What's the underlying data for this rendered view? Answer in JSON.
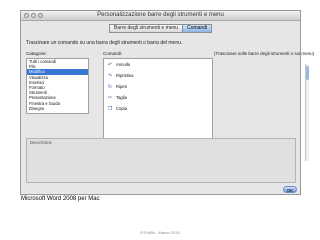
{
  "window": {
    "title": "Personalizzazione barre degli strumenti e menu",
    "tabs": [
      {
        "label": "Barre degli strumenti e menu"
      },
      {
        "label": "Comandi"
      }
    ]
  },
  "instruction": "Trascinare un comando su una barra degli strumenti o barra del menu.",
  "categories": {
    "label": "Categorie:",
    "items": [
      "Tutti i comandi",
      "File",
      "Modifica",
      "Visualizza",
      "Inserisci",
      "Formato",
      "Strumenti",
      "Presentazione",
      "Finestra e Guida",
      "Disegno"
    ],
    "selected_index": 2
  },
  "commands": {
    "label": "Comandi:",
    "hint": "(Trascinare sulle barre degli strumenti o sui menu)",
    "items": [
      {
        "label": "Annulla",
        "icon": "undo-icon"
      },
      {
        "label": "Ripristina",
        "icon": "redo-icon"
      },
      {
        "label": "Ripeti",
        "icon": "repeat-icon"
      },
      {
        "label": "Taglia",
        "icon": "scissors-icon"
      },
      {
        "label": "Copia",
        "icon": "copy-icon"
      }
    ]
  },
  "description": {
    "label": "Descrizione"
  },
  "ok_label": "OK",
  "caption": "Microsoft Word 2008 per Mac",
  "footer": "R.Polillo - Marzo 2015"
}
